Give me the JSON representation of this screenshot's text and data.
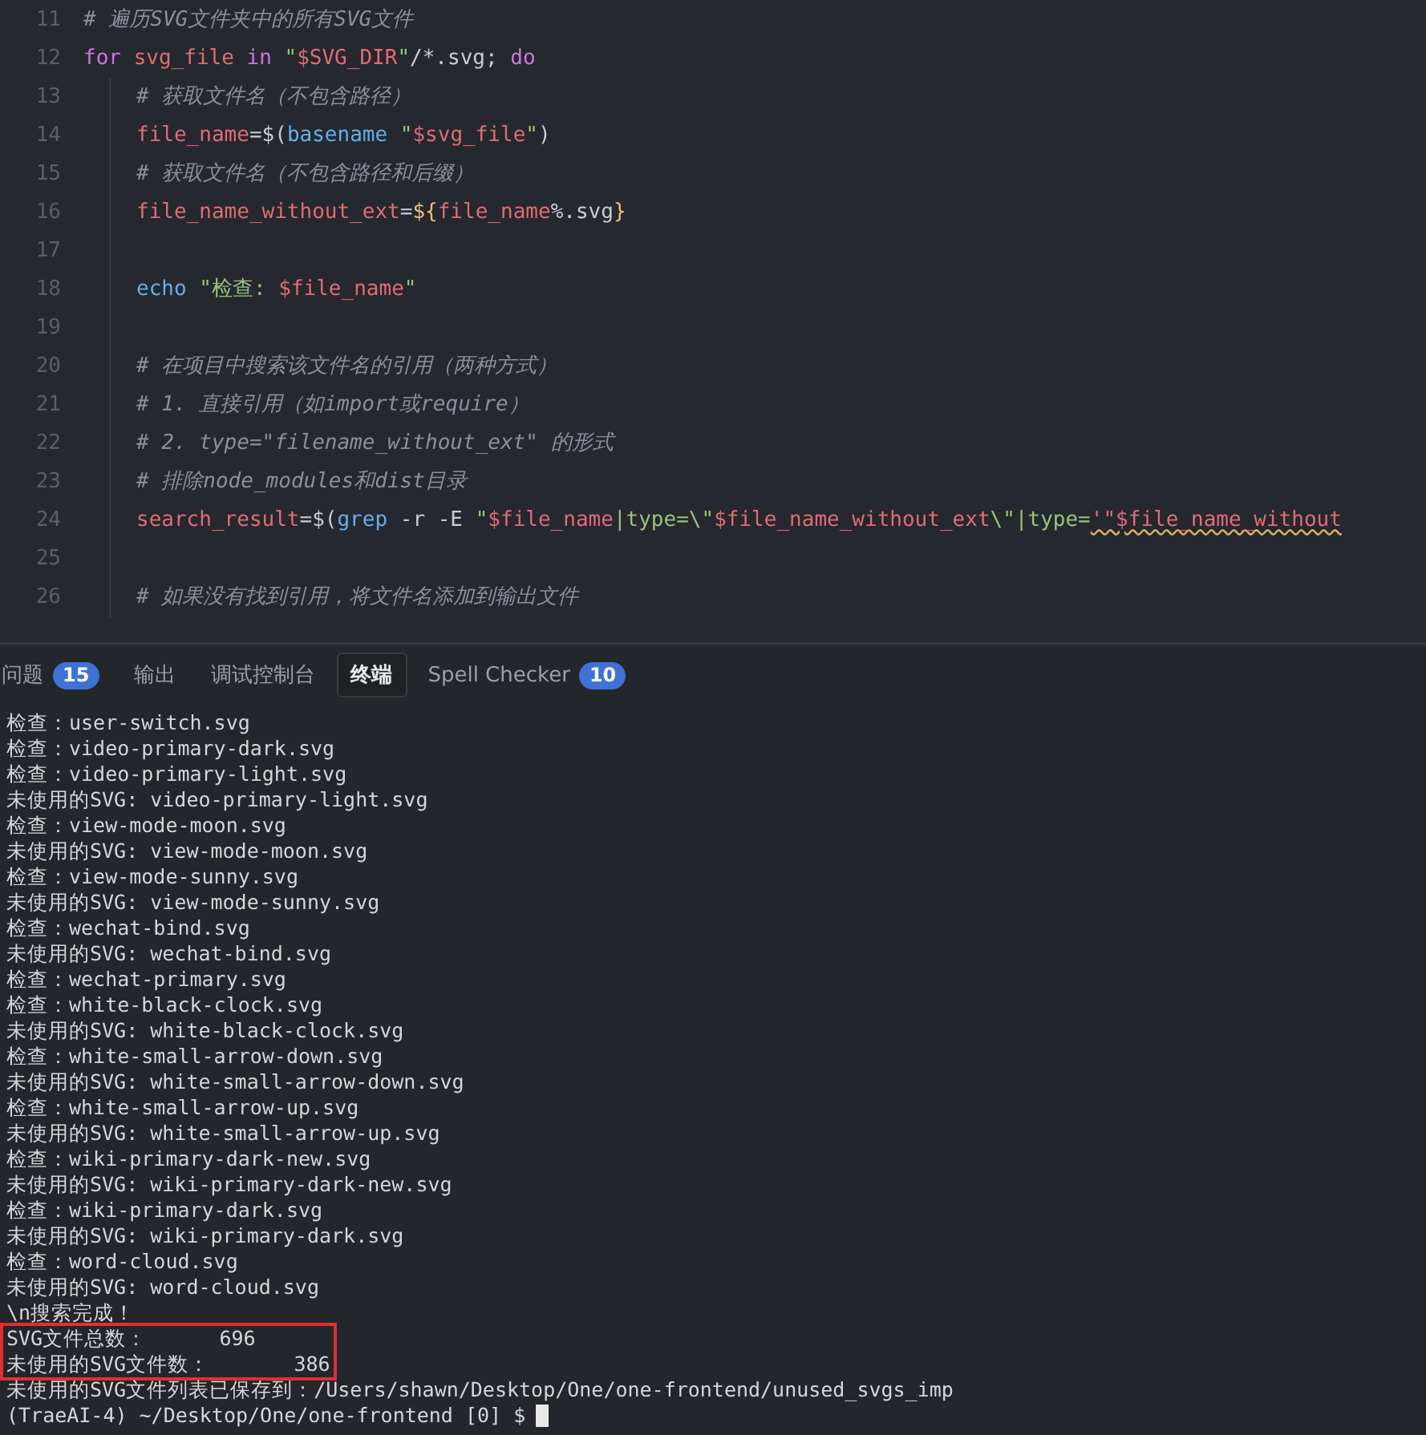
{
  "editor": {
    "lines": [
      {
        "number": "11",
        "indented": false,
        "tokens": [
          {
            "kind": "comment",
            "text": "# 遍历SVG文件夹中的所有SVG文件"
          }
        ]
      },
      {
        "number": "12",
        "indented": false,
        "tokens": [
          {
            "kind": "keyword",
            "text": "for "
          },
          {
            "kind": "variable",
            "text": "svg_file "
          },
          {
            "kind": "keyword",
            "text": "in "
          },
          {
            "kind": "string",
            "text": "\""
          },
          {
            "kind": "variable",
            "text": "$SVG_DIR"
          },
          {
            "kind": "string",
            "text": "\""
          },
          {
            "kind": "plain",
            "text": "/*.svg; "
          },
          {
            "kind": "keyword",
            "text": "do"
          }
        ]
      },
      {
        "number": "13",
        "indented": true,
        "tokens": [
          {
            "kind": "comment",
            "text": "# 获取文件名（不包含路径）"
          }
        ]
      },
      {
        "number": "14",
        "indented": true,
        "tokens": [
          {
            "kind": "variable",
            "text": "file_name"
          },
          {
            "kind": "plain",
            "text": "=$("
          },
          {
            "kind": "command",
            "text": "basename "
          },
          {
            "kind": "string",
            "text": "\""
          },
          {
            "kind": "variable",
            "text": "$svg_file"
          },
          {
            "kind": "string",
            "text": "\""
          },
          {
            "kind": "plain",
            "text": ")"
          }
        ]
      },
      {
        "number": "15",
        "indented": true,
        "tokens": [
          {
            "kind": "comment",
            "text": "# 获取文件名（不包含路径和后缀）"
          }
        ]
      },
      {
        "number": "16",
        "indented": true,
        "tokens": [
          {
            "kind": "variable",
            "text": "file_name_without_ext"
          },
          {
            "kind": "plain",
            "text": "="
          },
          {
            "kind": "brace",
            "text": "${"
          },
          {
            "kind": "variable",
            "text": "file_name"
          },
          {
            "kind": "plain",
            "text": "%.svg"
          },
          {
            "kind": "brace",
            "text": "}"
          }
        ]
      },
      {
        "number": "17",
        "indented": true
      },
      {
        "number": "18",
        "indented": true,
        "tokens": [
          {
            "kind": "command",
            "text": "echo "
          },
          {
            "kind": "string",
            "text": "\"检查: "
          },
          {
            "kind": "variable",
            "text": "$file_name"
          },
          {
            "kind": "string",
            "text": "\""
          }
        ]
      },
      {
        "number": "19",
        "indented": true
      },
      {
        "number": "20",
        "indented": true,
        "tokens": [
          {
            "kind": "comment",
            "text": "# 在项目中搜索该文件名的引用（两种方式）"
          }
        ]
      },
      {
        "number": "21",
        "indented": true,
        "tokens": [
          {
            "kind": "comment",
            "text": "# 1. 直接引用（如import或require）"
          }
        ]
      },
      {
        "number": "22",
        "indented": true,
        "tokens": [
          {
            "kind": "comment",
            "text": "# 2. type=\"filename_without_ext\" 的形式"
          }
        ]
      },
      {
        "number": "23",
        "indented": true,
        "tokens": [
          {
            "kind": "comment",
            "text": "# 排除node_modules和dist目录"
          }
        ]
      },
      {
        "number": "24",
        "indented": true,
        "tokens": [
          {
            "kind": "variable",
            "text": "search_result"
          },
          {
            "kind": "plain",
            "text": "=$("
          },
          {
            "kind": "command",
            "text": "grep"
          },
          {
            "kind": "plain",
            "text": " -r -E "
          },
          {
            "kind": "string",
            "text": "\""
          },
          {
            "kind": "variable",
            "text": "$file_name"
          },
          {
            "kind": "string",
            "text": "|type=\\\""
          },
          {
            "kind": "variable",
            "text": "$file_name_without_ext"
          },
          {
            "kind": "string",
            "text": "\\\"|type="
          },
          {
            "kind": "misspelled",
            "text": "'\"$file_name_without"
          }
        ]
      },
      {
        "number": "25",
        "indented": true
      },
      {
        "number": "26",
        "indented": true,
        "tokens": [
          {
            "kind": "comment",
            "text": "# 如果没有找到引用，将文件名添加到输出文件"
          }
        ]
      }
    ]
  },
  "panel": {
    "tabs": [
      {
        "label": "问题",
        "badge": "15",
        "selected": false
      },
      {
        "label": "输出",
        "selected": false
      },
      {
        "label": "调试控制台",
        "selected": false
      },
      {
        "label": "终端",
        "selected": true
      },
      {
        "label": "Spell Checker",
        "badge": "10",
        "selected": false
      }
    ]
  },
  "terminal": {
    "lines": [
      {
        "text": "检查：user-switch.svg",
        "highlighted": false
      },
      {
        "text": "检查：video-primary-dark.svg",
        "highlighted": false
      },
      {
        "text": "检查：video-primary-light.svg",
        "highlighted": false
      },
      {
        "text": "未使用的SVG: video-primary-light.svg",
        "highlighted": false
      },
      {
        "text": "检查：view-mode-moon.svg",
        "highlighted": false
      },
      {
        "text": "未使用的SVG: view-mode-moon.svg",
        "highlighted": false
      },
      {
        "text": "检查：view-mode-sunny.svg",
        "highlighted": false
      },
      {
        "text": "未使用的SVG: view-mode-sunny.svg",
        "highlighted": false
      },
      {
        "text": "检查：wechat-bind.svg",
        "highlighted": false
      },
      {
        "text": "未使用的SVG: wechat-bind.svg",
        "highlighted": false
      },
      {
        "text": "检查：wechat-primary.svg",
        "highlighted": false
      },
      {
        "text": "检查：white-black-clock.svg",
        "highlighted": false
      },
      {
        "text": "未使用的SVG: white-black-clock.svg",
        "highlighted": false
      },
      {
        "text": "检查：white-small-arrow-down.svg",
        "highlighted": false
      },
      {
        "text": "未使用的SVG: white-small-arrow-down.svg",
        "highlighted": false
      },
      {
        "text": "检查：white-small-arrow-up.svg",
        "highlighted": false
      },
      {
        "text": "未使用的SVG: white-small-arrow-up.svg",
        "highlighted": false
      },
      {
        "text": "检查：wiki-primary-dark-new.svg",
        "highlighted": false
      },
      {
        "text": "未使用的SVG: wiki-primary-dark-new.svg",
        "highlighted": false
      },
      {
        "text": "检查：wiki-primary-dark.svg",
        "highlighted": false
      },
      {
        "text": "未使用的SVG: wiki-primary-dark.svg",
        "highlighted": false
      },
      {
        "text": "检查：word-cloud.svg",
        "highlighted": false
      },
      {
        "text": "未使用的SVG: word-cloud.svg",
        "highlighted": false
      },
      {
        "text": "\\n搜索完成！",
        "highlighted": false
      },
      {
        "text": "SVG文件总数：      696",
        "highlighted": true
      },
      {
        "text": "未使用的SVG文件数：       386",
        "highlighted": true
      },
      {
        "text": "未使用的SVG文件列表已保存到：/Users/shawn/Desktop/One/one-frontend/unused_svgs_imp",
        "highlighted": false
      }
    ],
    "prompt": "(TraeAI-4) ~/Desktop/One/one-frontend [0] $"
  }
}
